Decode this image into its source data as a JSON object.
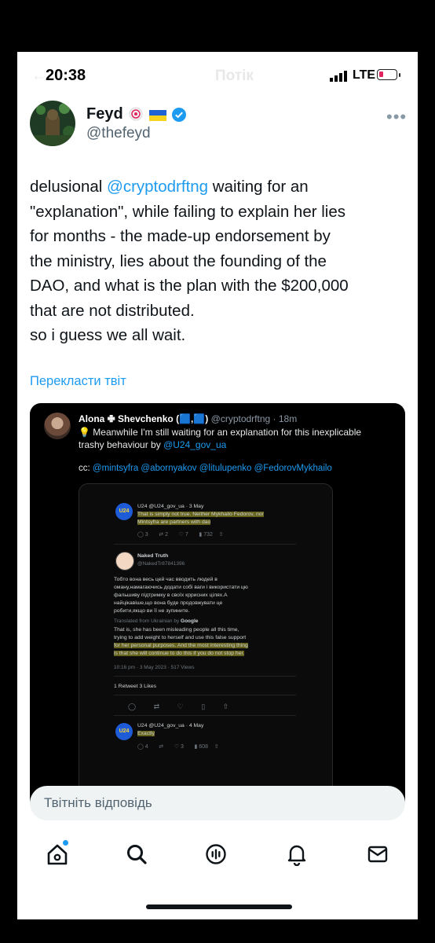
{
  "status_bar": {
    "time": "20:38",
    "network": "LTE",
    "ghost_title": "Потік"
  },
  "author": {
    "name": "Feyd",
    "handle": "@thefeyd"
  },
  "tweet": {
    "lines": [
      [
        "delusional ",
        "@cryptodrftng",
        " waiting for an"
      ],
      [
        "\"explanation\", while failing to explain her lies",
        "",
        ""
      ],
      [
        "for months - the made-up endorsement by",
        "",
        ""
      ],
      [
        "the ministry, lies about the founding of the",
        "",
        ""
      ],
      [
        "DAO, and what is the plan with the $200,000",
        "",
        ""
      ],
      [
        "that are not distributed.",
        "",
        ""
      ],
      [
        "so i guess we all wait.",
        "",
        ""
      ]
    ],
    "translate_label": "Перекласти твіт"
  },
  "embedded": {
    "name": "Alona ✙ Shevchenko (🟦,🟦)",
    "handle": "@cryptodrftng",
    "time": "· 18m",
    "text_1": "💡 Meanwhile I'm still waiting for an explanation for this inexplicable",
    "text_2": "trashy behaviour by ",
    "text_2_mention": "@U24_gov_ua",
    "cc_label": "cc: ",
    "cc_mentions": "@mintsyfra @abornyakov @litulupenko @FedorovMykhailo",
    "inner": {
      "u24_label": "U24",
      "t1_head": "U24 @U24_gov_ua · 3 May",
      "t1_line1": "That is simply not true. Neither Mykhailo Fedorov, nor",
      "t1_line2": "Mintsyfra are partners with dao",
      "t1_actions": [
        "3",
        "2",
        "7",
        "732"
      ],
      "nt_name": "Naked Truth",
      "nt_handle": "@NakedTr87841396",
      "ua_lines": [
        "Тобто вона весь цей час вводить людей в",
        "оману,намагаючись додати собі ваги і використати цю",
        "фальшиву підтримку в своїх кррисних цілях.А",
        "найцікавіше,що вона буде продовжувати це",
        "робити,якщо ви її не зупините."
      ],
      "translated_by": "Translated from Ukrainian by ",
      "google": "Google",
      "en_lines": [
        "That is, she has been misleading people all this time,",
        "trying to add weight to herself and use this false support",
        "for her personal purposes. And the most interesting thing",
        "is that she will continue to do this if you do not stop her."
      ],
      "meta": "10:16 pm · 3 May 2023 · 517 Views",
      "stats": "1 Retweet   3 Likes",
      "t3_head": "U24 @U24_gov_ua · 4 May",
      "t3_text": "Exactly",
      "t3_actions": [
        "4",
        "3",
        "608"
      ]
    }
  },
  "reply_placeholder": "Твітніть відповідь",
  "bottom_nav": [
    "home-icon",
    "search-icon",
    "spaces-icon",
    "notifications-icon",
    "messages-icon"
  ],
  "colors": {
    "accent": "#1d9bf0",
    "text": "#0f1419",
    "secondary": "#536471",
    "battery_low": "#e0245e"
  }
}
